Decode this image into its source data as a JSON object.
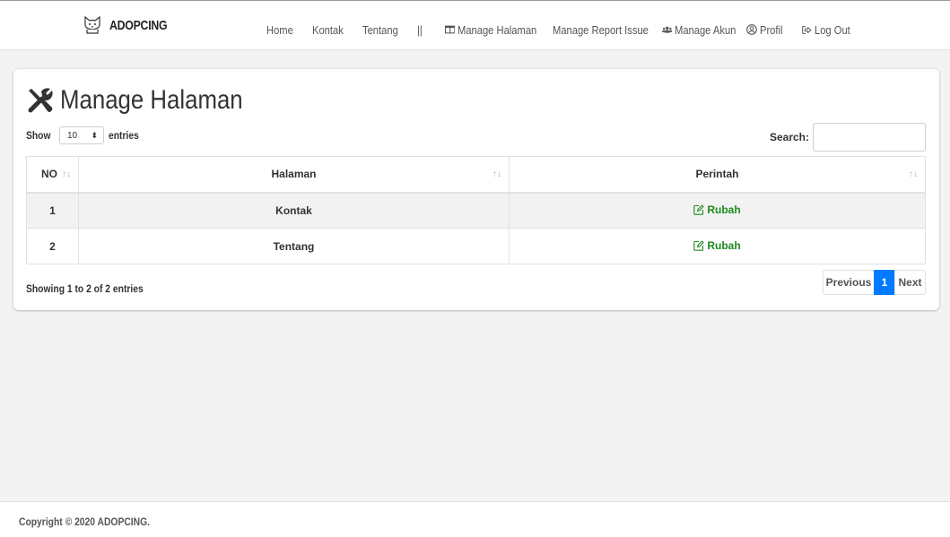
{
  "brand": {
    "name": "ADOPCING"
  },
  "nav": {
    "home": "Home",
    "kontak": "Kontak",
    "tentang": "Tentang",
    "separator": "||",
    "manage_halaman": "Manage Halaman",
    "manage_report": "Manage Report Issue",
    "manage_akun": "Manage Akun",
    "profil": "Profil",
    "logout": "Log Out"
  },
  "page": {
    "title": "Manage Halaman"
  },
  "table_controls": {
    "show_label": "Show",
    "entries_value": "10",
    "entries_label": "entries",
    "search_label": "Search:",
    "search_value": ""
  },
  "table": {
    "columns": [
      "NO",
      "Halaman",
      "Perintah"
    ],
    "rows": [
      {
        "no": "1",
        "halaman": "Kontak",
        "action": "Rubah"
      },
      {
        "no": "2",
        "halaman": "Tentang",
        "action": "Rubah"
      }
    ]
  },
  "info": "Showing 1 to 2 of 2 entries",
  "pagination": {
    "previous": "Previous",
    "current": "1",
    "next": "Next"
  },
  "footer": {
    "copyright": "Copyright © 2020 ADOPCING."
  },
  "colors": {
    "accent": "#007bff",
    "action": "#1c8a1c",
    "background": "#f3f3f3"
  },
  "icons": {
    "brand": "cat-logo-icon",
    "manage_halaman": "columns-icon",
    "manage_report": "exclamation-icon",
    "manage_akun": "users-icon",
    "profil": "user-circle-icon",
    "logout": "sign-out-icon",
    "title": "tools-icon",
    "action": "edit-icon"
  }
}
